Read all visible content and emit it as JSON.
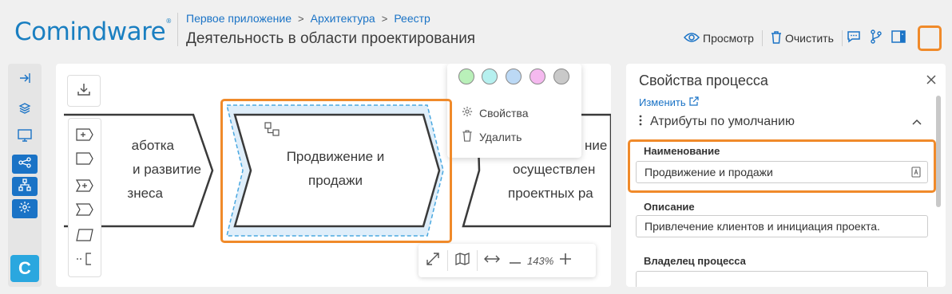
{
  "header": {
    "logo_part1": "Com",
    "logo_part2": "indware",
    "logo_reg": "®",
    "breadcrumb": [
      "Первое приложение",
      "Архитектура",
      "Реестр"
    ],
    "breadcrumb_sep": ">",
    "page_title": "Деятельность в области проектирования",
    "tools": {
      "preview_label": "Просмотр",
      "clear_label": "Очистить"
    }
  },
  "leftbar": {
    "items": [
      "collapse-icon",
      "layers-icon",
      "monitor-icon",
      "process-map-icon",
      "hierarchy-icon",
      "gear-icon"
    ],
    "logo_letter": "C"
  },
  "canvas": {
    "shapes": [
      {
        "line1": "аботка",
        "line2": "и развитие",
        "line3": "знеса"
      },
      {
        "line1": "Продвижение и",
        "line2": "продажи"
      },
      {
        "line1": "ние",
        "line2": "осуществлен",
        "line3": "проектных ра"
      }
    ],
    "context_menu": {
      "colors": [
        "#b9f0b9",
        "#b6f0ef",
        "#bcd9f5",
        "#f5b9ef",
        "#c9c9c9"
      ],
      "properties_label": "Свойства",
      "delete_label": "Удалить"
    },
    "zoom": {
      "value": "143%"
    }
  },
  "panel": {
    "title": "Свойства процесса",
    "edit_link": "Изменить",
    "section_title": "Атрибуты по умолчанию",
    "fields": {
      "name_label": "Наименование",
      "name_value": "Продвижение и продажи",
      "description_label": "Описание",
      "description_value": "Привлечение клиентов и инициация проекта.",
      "owner_label": "Владелец процесса"
    }
  },
  "colors": {
    "accent": "#1a73c6",
    "highlight": "#f08a2a",
    "selection": "#4aa8e0"
  }
}
